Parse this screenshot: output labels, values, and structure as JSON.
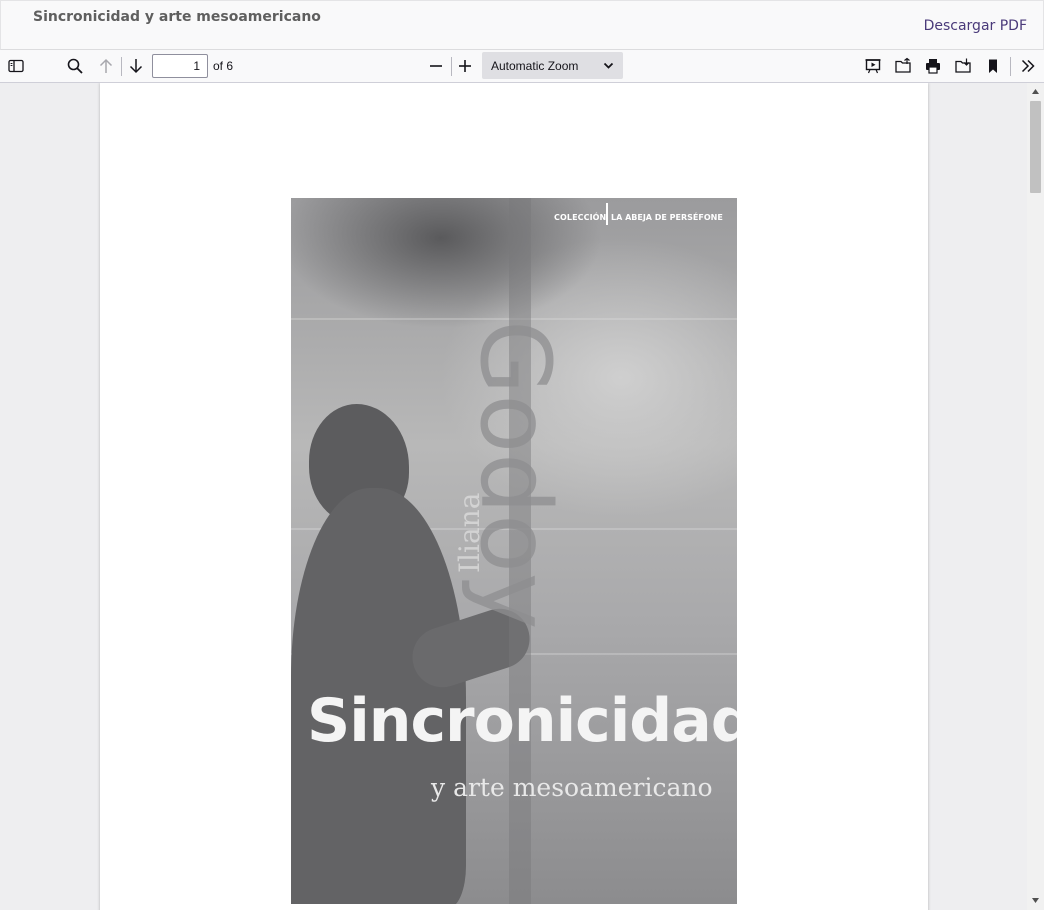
{
  "header": {
    "title": "Sincronicidad y arte mesoamericano",
    "download_label": "Descargar PDF"
  },
  "toolbar": {
    "page_number": "1",
    "page_count": "of 6",
    "zoom_label": "Automatic Zoom",
    "icons": [
      "sidebar-toggle-icon",
      "search-icon",
      "arrow-up-icon",
      "arrow-down-icon",
      "minus-icon",
      "plus-icon",
      "chevron-down-icon",
      "presentation-icon",
      "open-file-icon",
      "print-icon",
      "save-icon",
      "bookmark-icon",
      "double-chevron-right-icon"
    ]
  },
  "document": {
    "cover": {
      "collection_left": "COLECCIÓN",
      "collection_right": "LA ABEJA DE PERSÉFONE",
      "author_first": "Iliana",
      "author_last": "Godoy",
      "title": "Sincronicidad",
      "subtitle": "y arte mesoamericano"
    }
  },
  "colors": {
    "accent_link": "#4a3a7a",
    "toolbar_bg": "#f9f9fa",
    "viewer_bg": "#eeeef0"
  }
}
